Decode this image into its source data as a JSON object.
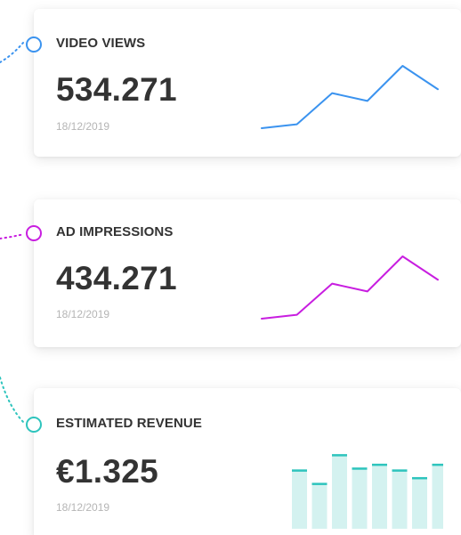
{
  "cards": [
    {
      "id": "video-views",
      "label": "VIDEO VIEWS",
      "value": "534.271",
      "date": "18/12/2019",
      "accent": "#3b93ef",
      "chart_data": {
        "type": "line",
        "values": [
          1,
          2,
          10,
          8,
          17,
          11
        ]
      }
    },
    {
      "id": "ad-impressions",
      "label": "AD IMPRESSIONS",
      "value": "434.271",
      "date": "18/12/2019",
      "accent": "#c81ee0",
      "chart_data": {
        "type": "line",
        "values": [
          1,
          2,
          10,
          8,
          17,
          11
        ]
      }
    },
    {
      "id": "estimated-revenue",
      "label": "ESTIMATED REVENUE",
      "value": "€1.325",
      "date": "18/12/2019",
      "accent": "#2ec4bd",
      "bar_fill": "#d4f2f0",
      "chart_data": {
        "type": "bar",
        "values": [
          62,
          48,
          78,
          64,
          68,
          62,
          54,
          68
        ]
      }
    }
  ]
}
